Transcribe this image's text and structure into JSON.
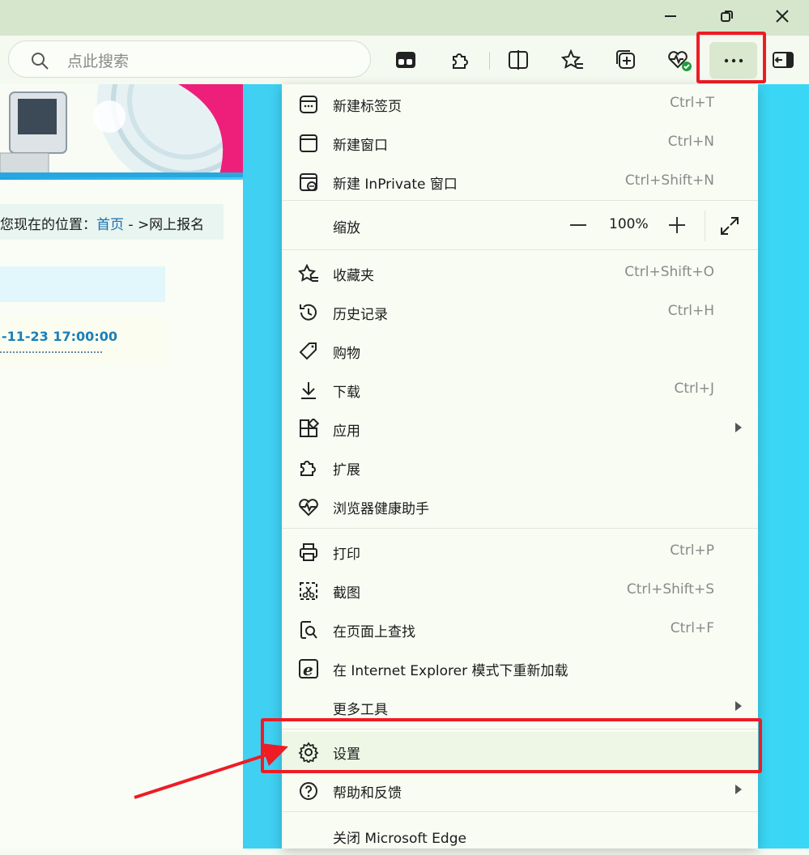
{
  "window": {
    "minimize_icon": "minimize-icon",
    "restore_icon": "restore-icon",
    "close_icon": "close-icon"
  },
  "toolbar": {
    "search_placeholder": "点此搜索",
    "icons": [
      "tab-actions-icon",
      "extensions-icon",
      "split-screen-icon",
      "favorites-icon",
      "collections-icon",
      "browser-essentials-icon",
      "more-icon",
      "sidebar-icon"
    ]
  },
  "webpage": {
    "breadcrumb_prefix": "您现在的位置：",
    "breadcrumb_home": "首页",
    "breadcrumb_rest": " - >网上报名",
    "deadline": "-11-23 17:00:00"
  },
  "menu": {
    "new_tab": {
      "label": "新建标签页",
      "shortcut": "Ctrl+T"
    },
    "new_window": {
      "label": "新建窗口",
      "shortcut": "Ctrl+N"
    },
    "new_inprivate": {
      "label": "新建 InPrivate 窗口",
      "shortcut": "Ctrl+Shift+N"
    },
    "zoom": {
      "label": "缩放",
      "value": "100%"
    },
    "favorites": {
      "label": "收藏夹",
      "shortcut": "Ctrl+Shift+O"
    },
    "history": {
      "label": "历史记录",
      "shortcut": "Ctrl+H"
    },
    "shopping": {
      "label": "购物"
    },
    "downloads": {
      "label": "下载",
      "shortcut": "Ctrl+J"
    },
    "apps": {
      "label": "应用"
    },
    "extensions": {
      "label": "扩展"
    },
    "health": {
      "label": "浏览器健康助手"
    },
    "print": {
      "label": "打印",
      "shortcut": "Ctrl+P"
    },
    "screenshot": {
      "label": "截图",
      "shortcut": "Ctrl+Shift+S"
    },
    "find": {
      "label": "在页面上查找",
      "shortcut": "Ctrl+F"
    },
    "ie_mode": {
      "label": "在 Internet Explorer 模式下重新加载"
    },
    "more_tools": {
      "label": "更多工具"
    },
    "settings": {
      "label": "设置"
    },
    "help": {
      "label": "帮助和反馈"
    },
    "close": {
      "label": "关闭 Microsoft Edge"
    }
  },
  "colors": {
    "highlight": "#ee1c25",
    "menu_bg": "#f8fcf3",
    "page_bg": "#2fc3ee"
  }
}
